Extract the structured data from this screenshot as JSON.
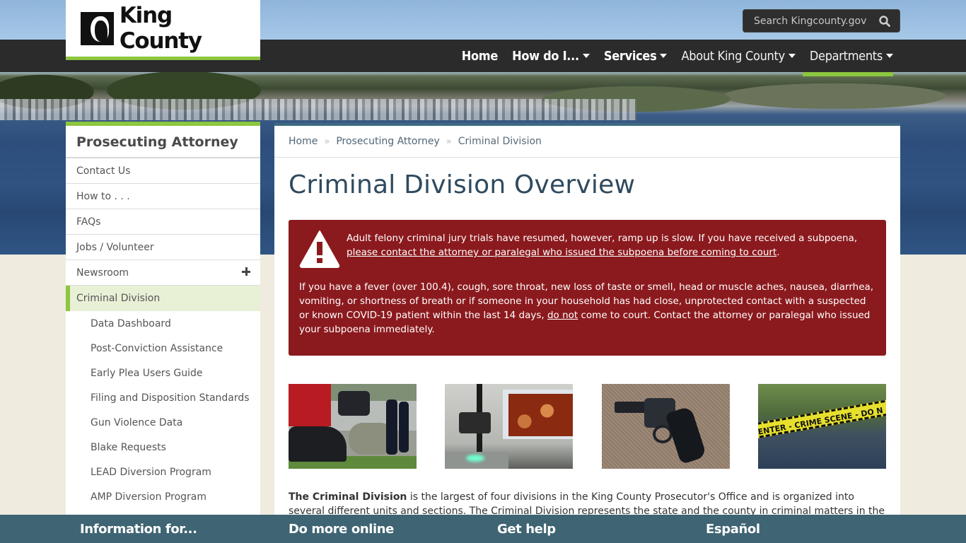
{
  "header": {
    "logo_text": "King County",
    "search_placeholder": "Search Kingcounty.gov",
    "nav": [
      {
        "label": "Home",
        "dropdown": false,
        "active": false
      },
      {
        "label": "How do I...",
        "dropdown": true,
        "active": false
      },
      {
        "label": "Services",
        "dropdown": true,
        "active": false
      },
      {
        "label": "About King County",
        "dropdown": true,
        "active": false
      },
      {
        "label": "Departments",
        "dropdown": true,
        "active": true
      }
    ]
  },
  "sidebar": {
    "title": "Prosecuting Attorney",
    "items": [
      {
        "label": "Contact Us"
      },
      {
        "label": "How to . . ."
      },
      {
        "label": "FAQs"
      },
      {
        "label": "Jobs / Volunteer"
      },
      {
        "label": "Newsroom",
        "expandable": true
      },
      {
        "label": "Criminal Division",
        "active": true
      }
    ],
    "sub_items": [
      {
        "label": "Data Dashboard"
      },
      {
        "label": "Post-Conviction Assistance"
      },
      {
        "label": "Early Plea Users Guide"
      },
      {
        "label": "Filing and Disposition Standards"
      },
      {
        "label": "Gun Violence Data"
      },
      {
        "label": "Blake Requests"
      },
      {
        "label": "LEAD Diversion Program"
      },
      {
        "label": "AMP Diversion Program"
      }
    ]
  },
  "breadcrumb": [
    {
      "label": "Home"
    },
    {
      "label": "Prosecuting Attorney"
    },
    {
      "label": "Criminal Division"
    }
  ],
  "main": {
    "title": "Criminal Division Overview",
    "alert": {
      "line1": "Adult felony criminal jury trials have resumed, however, ramp up is slow. If you have received a subpoena,",
      "line1_link": "please contact the attorney or paralegal who issued the subpoena before coming to court",
      "line1_end": ".",
      "p2_start": "If you have a fever (over 100.4), cough, sore throat, new loss of taste or smell, head or muscle aches, nausea, diarrhea, vomiting, or shortness of breath or if someone in your household has had close, unprotected contact with a suspected or known COVID-19 patient within the last 14 days, ",
      "p2_underline": "do not",
      "p2_end": " come to court. Contact the attorney or paralegal who issued your subpoena immediately."
    },
    "images": [
      {
        "alt": "car accident scene with police"
      },
      {
        "alt": "forensic lab microscope and monitor"
      },
      {
        "alt": "revolver handgun"
      },
      {
        "alt": "crime scene tape",
        "tape_text": "ENTER - CRIME SCENE - DO N"
      }
    ],
    "intro_bold": "The Criminal Division",
    "intro_text": " is the largest of four divisions in the King County Prosecutor's Office and is organized into several different units and sections. The Criminal Division represents the state and the county in criminal matters in the King County"
  },
  "footer": {
    "items": [
      {
        "label": "Information for..."
      },
      {
        "label": "Do more online"
      },
      {
        "label": "Get help"
      },
      {
        "label": "Español"
      }
    ]
  },
  "colors": {
    "accent_green": "#8dc63f",
    "alert_red": "#8b1a1e",
    "footer_teal": "#3f6473",
    "navbar_dark": "#2b2b2b",
    "page_bg": "#efebdf",
    "title_blue": "#2f4a5e"
  }
}
